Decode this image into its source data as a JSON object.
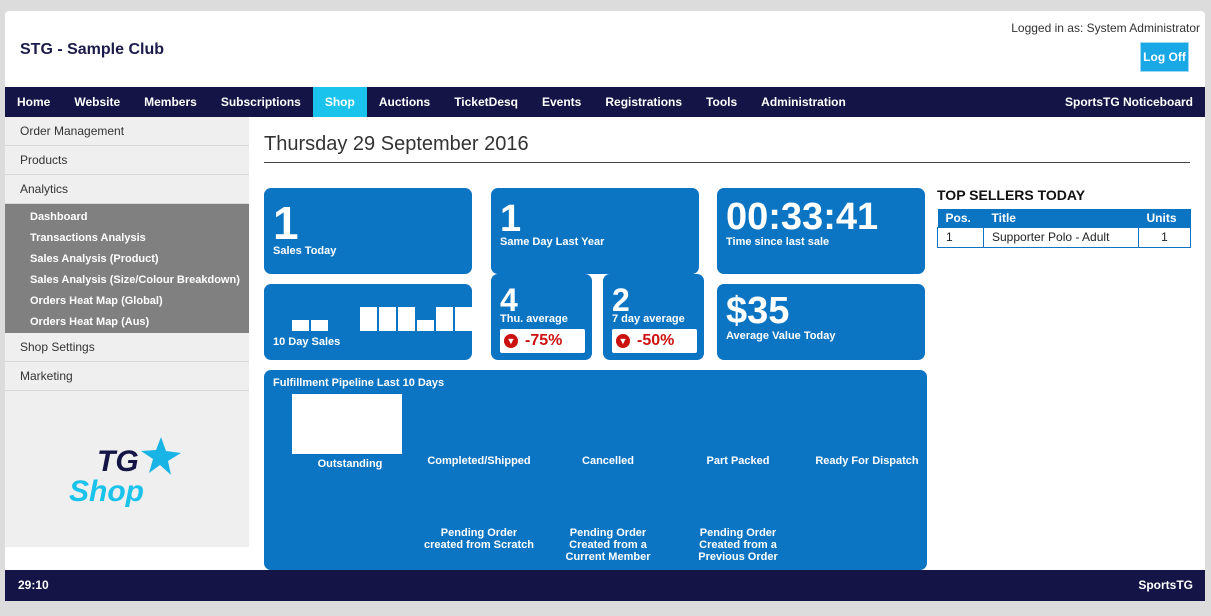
{
  "header": {
    "club_name": "STG - Sample Club",
    "logged_in": "Logged in as: System Administrator",
    "logoff_label": "Log Off"
  },
  "nav": {
    "items": [
      "Home",
      "Website",
      "Members",
      "Subscriptions",
      "Shop",
      "Auctions",
      "TicketDesq",
      "Events",
      "Registrations",
      "Tools",
      "Administration"
    ],
    "active": "Shop",
    "right_label": "SportsTG Noticeboard"
  },
  "sidebar": {
    "items_top": [
      "Order Management",
      "Products",
      "Analytics"
    ],
    "analytics_sub": [
      "Dashboard",
      "Transactions Analysis",
      "Sales Analysis (Product)",
      "Sales Analysis (Size/Colour Breakdown)",
      "Orders Heat Map (Global)",
      "Orders Heat Map (Aus)"
    ],
    "items_bottom": [
      "Shop Settings",
      "Marketing"
    ],
    "logo_text_top": "TG",
    "logo_text_bottom": "Shop"
  },
  "main": {
    "date_title": "Thursday 29 September 2016"
  },
  "tiles": {
    "sales_today": {
      "value": "1",
      "label": "Sales Today"
    },
    "same_day_last_year": {
      "value": "1",
      "label": "Same Day Last Year"
    },
    "time_since_last_sale": {
      "value": "00:33:41",
      "label": "Time since last sale"
    },
    "ten_day_sales": {
      "label": "10 Day Sales",
      "bar_levels": [
        0.4,
        0.4,
        0,
        0.9,
        0.9,
        0.9,
        0.4,
        0.9,
        0.9
      ]
    },
    "thu_average": {
      "value": "4",
      "label": "Thu. average",
      "change": "-75%"
    },
    "seven_day_average": {
      "value": "2",
      "label": "7 day average",
      "change": "-50%"
    },
    "average_value_today": {
      "value": "$35",
      "label": "Average Value Today"
    }
  },
  "pipeline": {
    "title": "Fulfillment Pipeline Last 10 Days",
    "stages_top": [
      "Outstanding",
      "Completed/Shipped",
      "Cancelled",
      "Part Packed",
      "Ready For Dispatch"
    ],
    "pending_scratch": [
      "Pending Order",
      "created from Scratch"
    ],
    "pending_member": [
      "Pending Order",
      "Created from a",
      "Current Member"
    ],
    "pending_previous": [
      "Pending Order",
      "Created from a",
      "Previous Order"
    ]
  },
  "top_sellers": {
    "title": "TOP SELLERS TODAY",
    "columns": [
      "Pos.",
      "Title",
      "Units"
    ],
    "rows": [
      [
        "1",
        "Supporter Polo - Adult",
        "1"
      ]
    ]
  },
  "footer": {
    "timer": "29:10",
    "brand": "SportsTG"
  },
  "colors": {
    "nav_bg": "#141446",
    "tile_blue": "#0c75c3",
    "active_tab": "#19c3ec",
    "logoff": "#19a7e6",
    "negative": "#cc1111"
  }
}
